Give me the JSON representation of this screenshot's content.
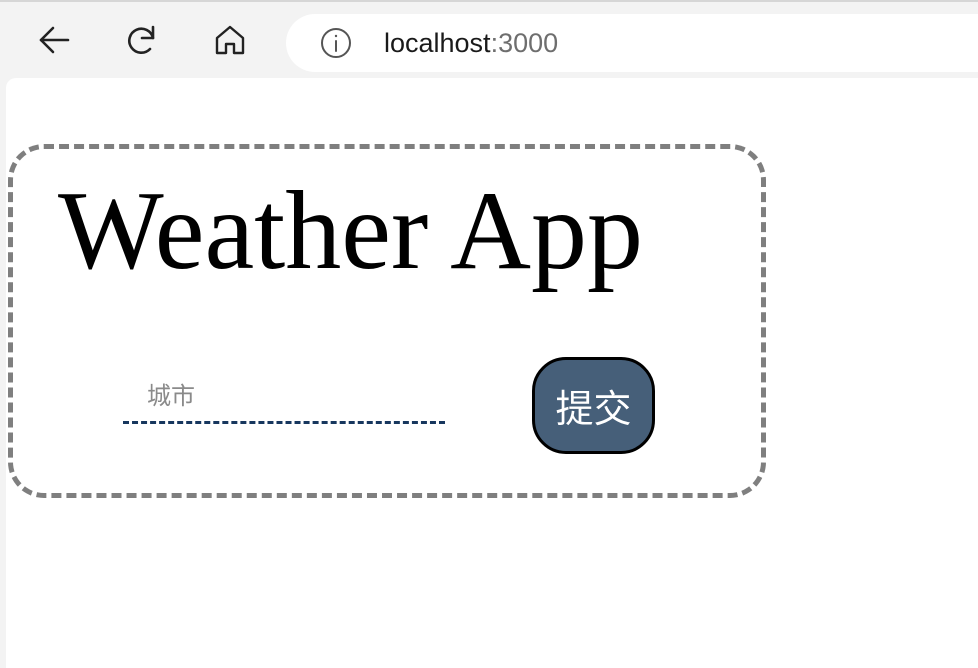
{
  "browser": {
    "url_host": "localhost",
    "url_port": ":3000"
  },
  "icons": {
    "back": "arrow-left-icon",
    "reload": "reload-icon",
    "home": "home-icon",
    "info": "info-icon"
  },
  "app": {
    "title": "Weather App",
    "city_placeholder": "城市",
    "city_value": "",
    "submit_label": "提交"
  },
  "colors": {
    "button_bg": "#465f79",
    "input_underline": "#17375e",
    "card_border": "#7f7f7f"
  }
}
